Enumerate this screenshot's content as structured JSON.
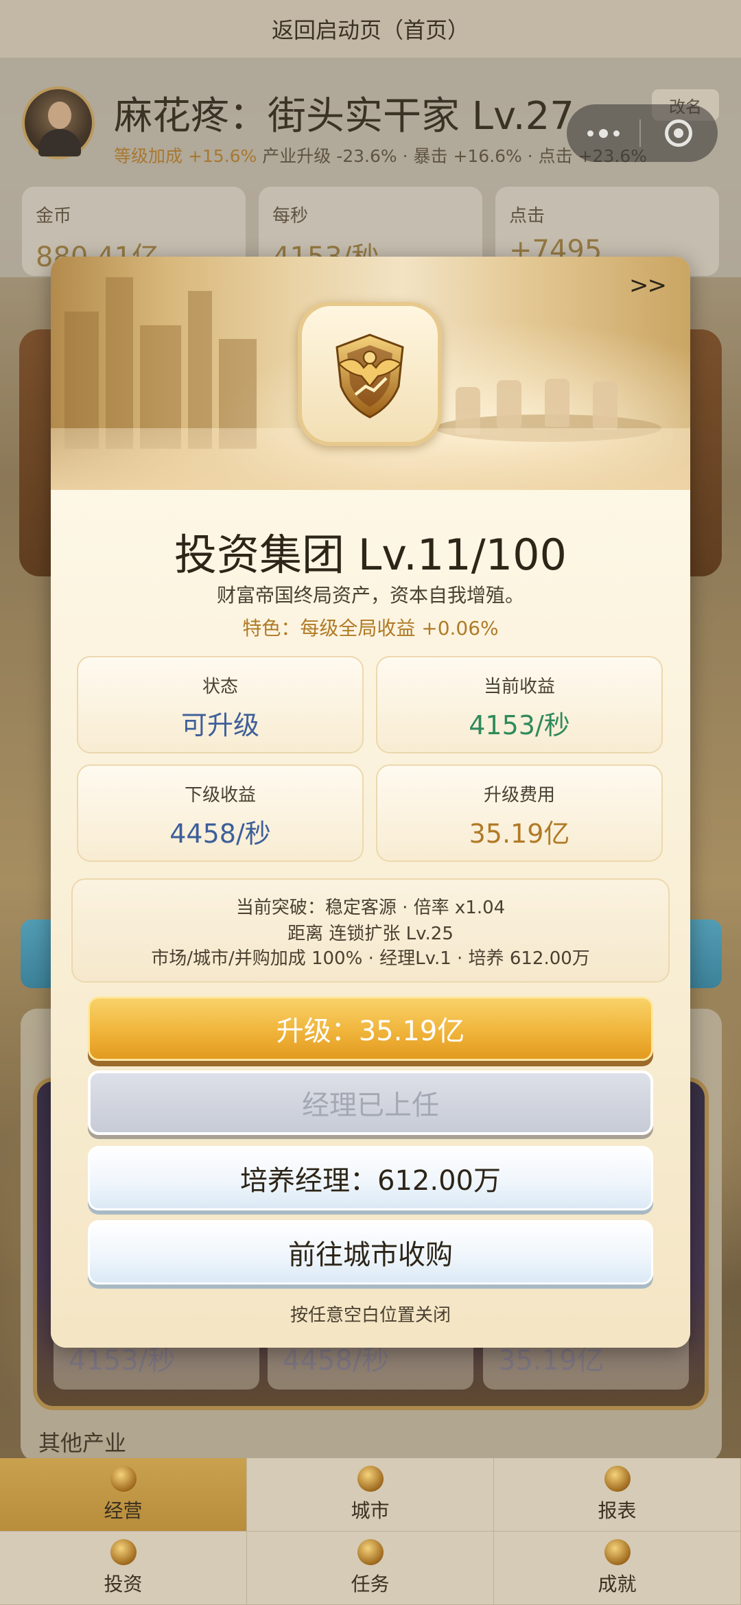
{
  "header": {
    "back_label": "返回启动页（首页）"
  },
  "profile": {
    "name": "麻花疼：街头实干家 Lv.27",
    "bonus_level": "等级加成 +15.6%",
    "bonus_rest": " 产业升级 -23.6% · 暴击 +16.6% · 点击 +23.6%",
    "rename_label": "改名"
  },
  "stats": [
    {
      "label": "金币",
      "value": "880.41亿"
    },
    {
      "label": "每秒",
      "value": "4153/秒"
    },
    {
      "label": "点击",
      "value": "+7495"
    }
  ],
  "background": {
    "cards": [
      "4153/秒",
      "4458/秒",
      "35.19亿"
    ],
    "other_label": "其他产业"
  },
  "modal": {
    "next_label": ">>",
    "icon": "eagle-shield-emblem-icon",
    "title": "投资集团 Lv.11/100",
    "description": "财富帝国终局资产，资本自我增殖。",
    "feature": "特色：每级全局收益 +0.06%",
    "cards": {
      "status": {
        "label": "状态",
        "value": "可升级"
      },
      "current": {
        "label": "当前收益",
        "value": "4153/秒"
      },
      "next": {
        "label": "下级收益",
        "value": "4458/秒"
      },
      "cost": {
        "label": "升级费用",
        "value": "35.19亿"
      }
    },
    "breakthrough": {
      "line1": "当前突破：稳定客源 · 倍率 x1.04",
      "line2": "距离 连锁扩张 Lv.25",
      "line3": "市场/城市/并购加成 100% · 经理Lv.1 · 培养 612.00万"
    },
    "buttons": {
      "upgrade": "升级：35.19亿",
      "manager": "经理已上任",
      "train": "培养经理：612.00万",
      "city": "前往城市收购"
    },
    "close_hint": "按任意空白位置关闭"
  },
  "tabs": [
    {
      "label": "经营",
      "icon": "coin-icon",
      "active": true
    },
    {
      "label": "城市",
      "icon": "city-icon"
    },
    {
      "label": "报表",
      "icon": "report-icon"
    },
    {
      "label": "投资",
      "icon": "invest-icon"
    },
    {
      "label": "任务",
      "icon": "task-icon"
    },
    {
      "label": "成就",
      "icon": "achievement-icon"
    }
  ],
  "colors": {
    "accent_gold": "#b07a26",
    "value_blue": "#3d5f9a",
    "value_green": "#2f8a5a",
    "upgrade_button": "#f0b43a"
  }
}
